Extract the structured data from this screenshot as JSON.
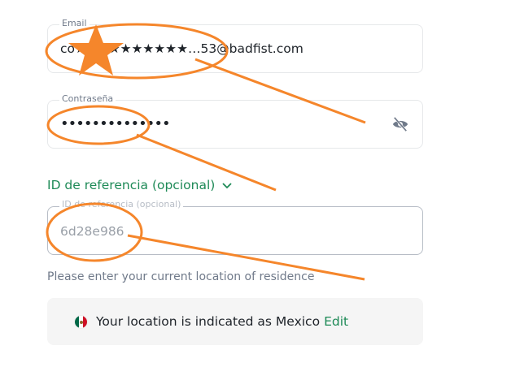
{
  "email": {
    "label": "Email",
    "value": "co★★★★★★★★★★…53@badfist.com"
  },
  "password": {
    "label": "Contraseña",
    "value": "••••••••••••••"
  },
  "referral": {
    "toggle_label": "ID de referencia (opcional)",
    "field_label": "ID de referencia (opcional)",
    "value": "6d28e986"
  },
  "location": {
    "hint": "Please enter your current location of residence",
    "text": "Your location is indicated as Mexico",
    "edit_label": "Edit"
  },
  "colors": {
    "accent": "#1e8a57",
    "annotation": "#f5862b"
  },
  "icons": {
    "password_toggle": "eye-slash-icon",
    "chevron": "chevron-down-icon",
    "flag": "mexico-flag-icon",
    "redaction": "star-icon"
  }
}
